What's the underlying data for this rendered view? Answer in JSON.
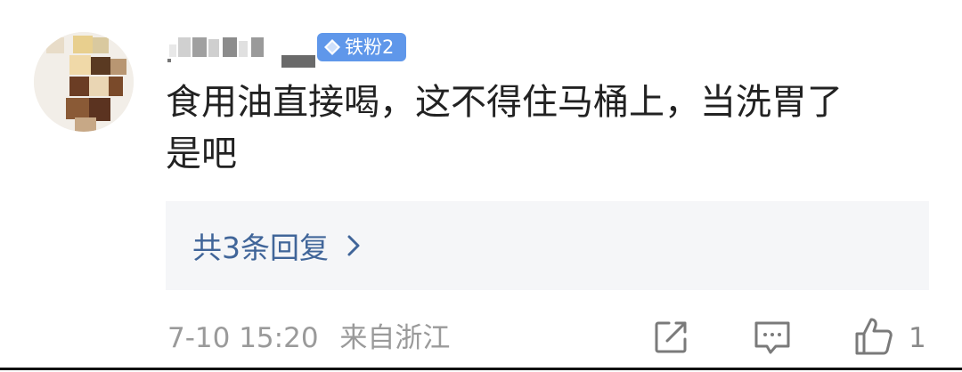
{
  "comment": {
    "username": "",
    "badge": {
      "label": "铁粉2",
      "icon": "diamond-icon",
      "color": "#5f97ea"
    },
    "text_line1": "食用油直接喝，这不得住马桶上，当洗胃了",
    "text_line2": "是吧",
    "replies_label": "共3条回复",
    "timestamp": "7-10 15:20",
    "location": "来自浙江",
    "like_count": "1"
  },
  "colors": {
    "reply_link": "#406599",
    "meta_text": "#9a9a9a",
    "reply_bg": "#f5f6f8",
    "text": "#222222"
  }
}
